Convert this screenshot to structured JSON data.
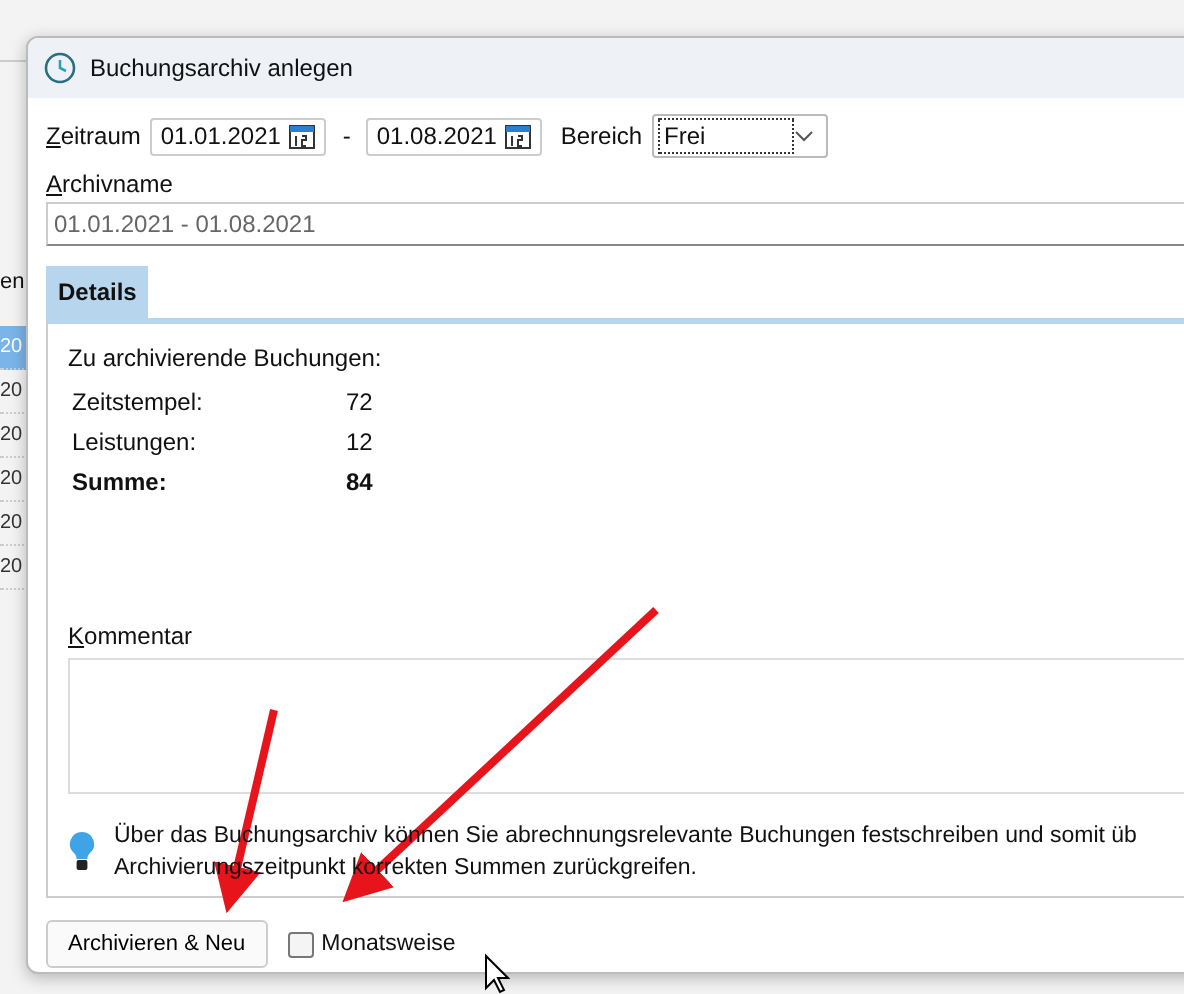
{
  "background_app": {
    "label": "en",
    "rows": [
      {
        "text": "20",
        "selected": true
      },
      {
        "text": "20",
        "selected": false
      },
      {
        "text": "20",
        "selected": false
      },
      {
        "text": "20",
        "selected": false
      },
      {
        "text": "20",
        "selected": false
      },
      {
        "text": "20",
        "selected": false
      }
    ]
  },
  "dialog": {
    "title": "Buchungsarchiv anlegen",
    "zeitraum": {
      "label": "Zeitraum",
      "from": "01.01.2021",
      "separator": "-",
      "to": "01.08.2021"
    },
    "bereich": {
      "label": "Bereich",
      "value": "Frei"
    },
    "archivname": {
      "label": "Archivname",
      "value": "01.01.2021 - 01.08.2021"
    },
    "tabs": [
      {
        "label": "Details",
        "selected": true
      }
    ],
    "details": {
      "heading": "Zu archivierende Buchungen:",
      "rows": [
        {
          "label": "Zeitstempel:",
          "value": "72",
          "bold": false
        },
        {
          "label": "Leistungen:",
          "value": "12",
          "bold": false
        },
        {
          "label": "Summe:",
          "value": "84",
          "bold": true
        }
      ]
    },
    "kommentar": {
      "label": "Kommentar"
    },
    "info": {
      "lines": [
        "Über das Buchungsarchiv können Sie abrechnungsrelevante Buchungen festschreiben und somit üb",
        "Archivierungszeitpunkt korrekten Summen zurückgreifen."
      ]
    },
    "button": "Archivieren & Neu",
    "monatsweise": {
      "label": "Monatsweise",
      "checked": false
    }
  }
}
